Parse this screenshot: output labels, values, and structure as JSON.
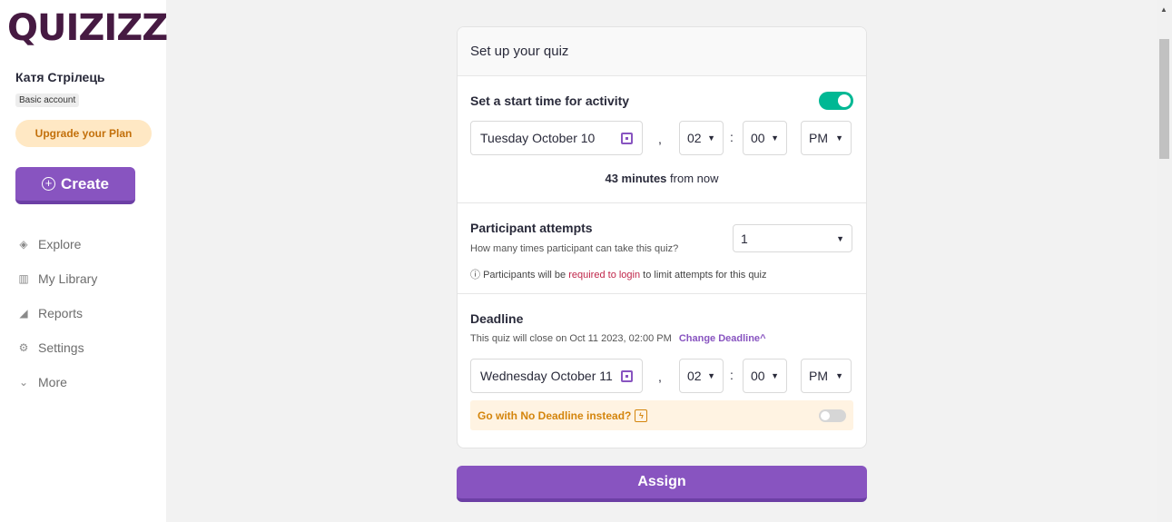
{
  "sidebar": {
    "logo": "QUIZIZZ",
    "user_name": "Катя Стрілець",
    "account_type": "Basic account",
    "upgrade_label": "Upgrade your Plan",
    "create_label": "Create",
    "nav": [
      {
        "label": "Explore",
        "icon": "explore-icon"
      },
      {
        "label": "My Library",
        "icon": "library-icon"
      },
      {
        "label": "Reports",
        "icon": "reports-icon"
      },
      {
        "label": "Settings",
        "icon": "settings-icon"
      },
      {
        "label": "More",
        "icon": "chevron-down-icon"
      }
    ]
  },
  "card": {
    "header": "Set up your quiz",
    "start": {
      "title": "Set a start time for activity",
      "toggle_on": true,
      "date": "Tuesday October 10",
      "hour": "02",
      "minute": "00",
      "ampm": "PM",
      "minutes_count": "43 minutes",
      "from_now": "from now"
    },
    "attempts": {
      "title": "Participant attempts",
      "subtitle": "How many times participant can take this quiz?",
      "value": "1",
      "note_prefix": "Participants will be",
      "note_link": "required to login",
      "note_suffix": "to limit attempts for this quiz"
    },
    "deadline": {
      "title": "Deadline",
      "close_text": "This quiz will close on Oct 11 2023, 02:00 PM",
      "change_label": "Change Deadline",
      "date": "Wednesday October 11",
      "hour": "02",
      "minute": "00",
      "ampm": "PM",
      "no_deadline_label": "Go with No Deadline instead?",
      "no_deadline_on": false
    }
  },
  "assign_label": "Assign",
  "colors": {
    "brand_purple": "#8854c0",
    "toggle_green": "#00b894",
    "upgrade_bg": "#ffe8c4",
    "warning_orange": "#d4850d"
  }
}
